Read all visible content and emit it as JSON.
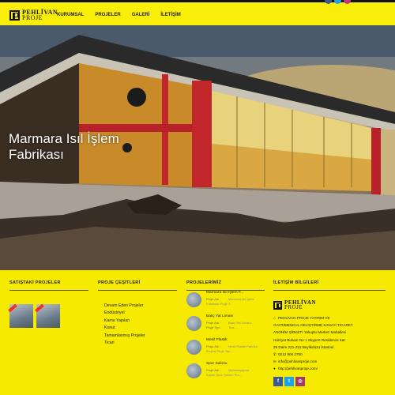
{
  "header": {
    "logo_line1": "PEHLİVAN",
    "logo_line2": "PROJE",
    "nav": [
      "KURUMSAL",
      "PROJELER",
      "GALERİ",
      "İLETİŞİM"
    ],
    "social_colors": [
      "#3b5998",
      "#1da1f2",
      "#c13584"
    ]
  },
  "hero": {
    "title": "Marmara Isıl İşlem Fabrikası"
  },
  "footer": {
    "satistaki": {
      "title": "SATIŞTAKİ PROJELER",
      "thumbs": [
        "thumb-1",
        "thumb-2"
      ]
    },
    "cesitler": {
      "title": "PROJE ÇEŞİTLERİ",
      "items": [
        "Devam Eden Projeler",
        "Endüstriyel",
        "Kamu Yapıları",
        "Konut",
        "Tamamlanmış Projeler",
        "Ticari"
      ]
    },
    "projelerimiz": {
      "title": "PROJELERİMİZ",
      "items": [
        {
          "name": "Marmara Isıl İşlem F...",
          "k1": "Proje Adı :",
          "v1": "Marmara Isıl İşlem",
          "k2": "",
          "v2": "Fabrikası Proje T..."
        },
        {
          "name": "Balıç Yat Limanı",
          "k1": "Proje Adı :",
          "v1": "Balıç Yat Limanı",
          "k2": "Proje Tipi :",
          "v2": "Tica..."
        },
        {
          "name": "Mesil Plastik",
          "k1": "Proje Adı :",
          "v1": "Mesil Plastik Fabrika",
          "k2": "",
          "v2": "Projesi Proje Tipi :..."
        },
        {
          "name": "Spor Salonu",
          "k1": "Proje Adı :",
          "v1": "Mehmetçayına",
          "k2": "",
          "v2": "Kapalı Spor Salonu Pro..."
        }
      ]
    },
    "iletisim": {
      "title": "İLETİŞİM BİLGİLERİ",
      "logo_line1": "PEHLİVAN",
      "logo_line2": "PROJE",
      "lines": [
        {
          "icon": "home-icon",
          "glyph": "⌂",
          "text": "PEHLİVAN PROJE YATIRIM VE"
        },
        {
          "icon": "",
          "glyph": "",
          "text": "GAYRİMENKUL GELİŞTİRME SANAYİ TİCARET"
        },
        {
          "icon": "",
          "glyph": "",
          "text": "ANONİM ŞİRKETİ Yakuplu Merkez Mahallesi"
        },
        {
          "icon": "",
          "glyph": "",
          "text": "Hürriyet Bulvarı No 1 Skyport Residence Kat"
        },
        {
          "icon": "",
          "glyph": "",
          "text": "29 Daire 221-222 Beylikdüzü İstanbul"
        },
        {
          "icon": "phone-icon",
          "glyph": "✆",
          "text": "0212 806 2750"
        },
        {
          "icon": "mail-icon",
          "glyph": "✉",
          "text": "info@pehlivanproje.com"
        },
        {
          "icon": "globe-icon",
          "glyph": "●",
          "text": "http://pehlivanproje.com/"
        }
      ],
      "social": [
        {
          "name": "facebook-icon",
          "glyph": "f",
          "color": "#3b5998"
        },
        {
          "name": "twitter-icon",
          "glyph": "t",
          "color": "#1da1f2"
        },
        {
          "name": "instagram-icon",
          "glyph": "◎",
          "color": "#a33a6e"
        }
      ]
    }
  }
}
